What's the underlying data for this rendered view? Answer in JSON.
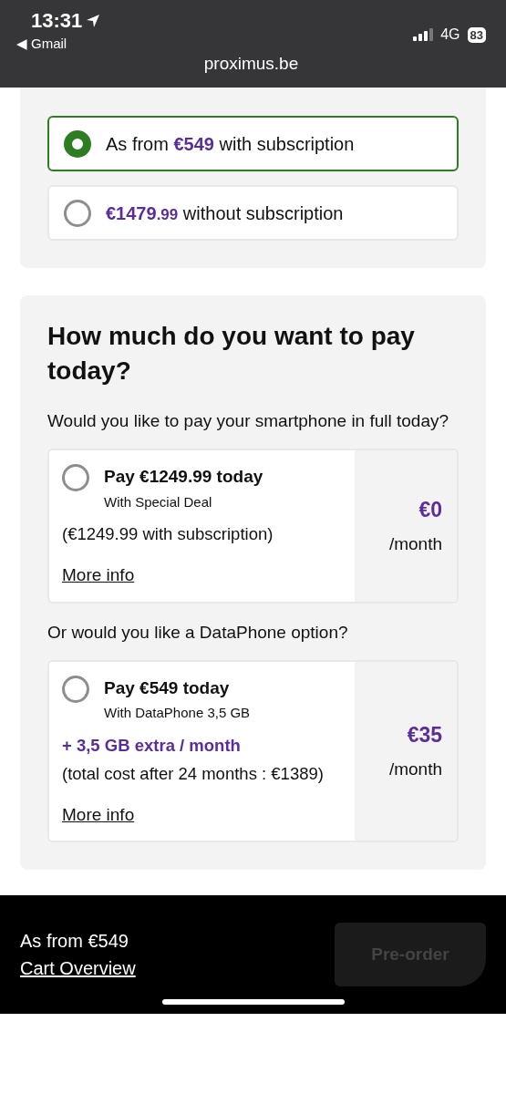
{
  "status_bar": {
    "time": "13:31",
    "back_glyph": "◀",
    "back_label": "Gmail",
    "network": "4G",
    "battery": "83",
    "url": "proximus.be"
  },
  "price_options": [
    {
      "prefix": "As from ",
      "price": "€549",
      "suffix": " with subscription",
      "selected": true
    },
    {
      "price": "€1479",
      "cents": ".99",
      "suffix": " without subscription",
      "selected": false
    }
  ],
  "payment": {
    "heading": "How much do you want to pay today?",
    "sections": [
      {
        "question": "Would you like to pay your smartphone in full today?",
        "plan": {
          "title": "Pay €1249.99 today",
          "subtitle": "With Special Deal",
          "details": "(€1249.99 with subscription)",
          "link": "More info",
          "price": "€0",
          "period": "/month",
          "selected": false
        }
      },
      {
        "question": "Or would you like a DataPhone option?",
        "plan": {
          "title": "Pay €549 today",
          "subtitle": "With DataPhone 3,5 GB",
          "extra": "+ 3,5 GB extra / month",
          "details": "(total cost after 24 months : €1389)",
          "link": "More info",
          "price": "€35",
          "period": "/month",
          "selected": false
        }
      }
    ]
  },
  "footer": {
    "price_text": "As from €549",
    "link": "Cart Overview",
    "button": {
      "label": "Pre-order",
      "disabled": true
    }
  }
}
